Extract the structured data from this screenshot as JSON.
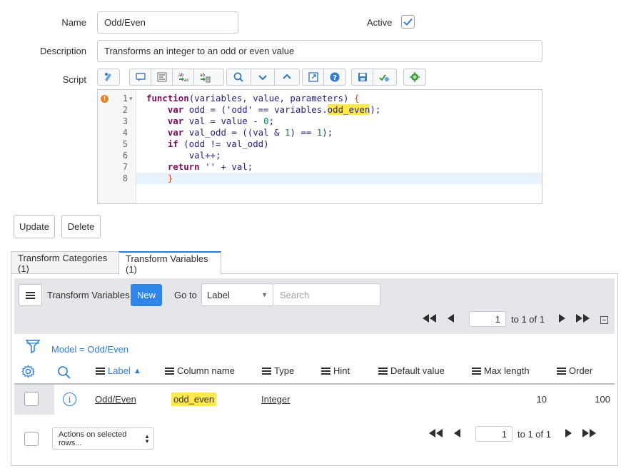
{
  "form": {
    "name_label": "Name",
    "name_value": "Odd/Even",
    "active_label": "Active",
    "active_checked": true,
    "description_label": "Description",
    "description_value": "Transforms an integer to an odd or even value",
    "script_label": "Script"
  },
  "toolbar": {
    "icons": [
      "script-assist-icon",
      "comment-icon",
      "format-icon",
      "replace-icon",
      "replace-all-icon",
      "search-icon",
      "collapse-icon",
      "expand-icon",
      "fullscreen-icon",
      "help-icon",
      "save-icon",
      "syntax-check-icon",
      "debug-icon"
    ]
  },
  "editor": {
    "line_numbers": [
      "1",
      "2",
      "3",
      "4",
      "5",
      "6",
      "7",
      "8"
    ],
    "fold_marker": "▾",
    "error_marker": "!",
    "lines": [
      {
        "indent": "",
        "parts": [
          [
            "kw",
            "function"
          ],
          [
            "p",
            "(variables, value, parameters) "
          ],
          [
            "brace",
            "{"
          ]
        ]
      },
      {
        "indent": "    ",
        "parts": [
          [
            "kw",
            "var"
          ],
          [
            "p",
            " odd = ("
          ],
          [
            "str",
            "'odd'"
          ],
          [
            "p",
            " == variables."
          ],
          [
            "hl",
            "odd_even"
          ],
          [
            "p",
            ");"
          ]
        ]
      },
      {
        "indent": "    ",
        "parts": [
          [
            "kw",
            "var"
          ],
          [
            "p",
            " val = value - "
          ],
          [
            "num",
            "0"
          ],
          [
            "p",
            ";"
          ]
        ]
      },
      {
        "indent": "    ",
        "parts": [
          [
            "kw",
            "var"
          ],
          [
            "p",
            " val_odd = ((val & "
          ],
          [
            "num",
            "1"
          ],
          [
            "p",
            ") == "
          ],
          [
            "num",
            "1"
          ],
          [
            "p",
            ");"
          ]
        ]
      },
      {
        "indent": "    ",
        "parts": [
          [
            "kw",
            "if"
          ],
          [
            "p",
            " (odd != val_odd)"
          ]
        ]
      },
      {
        "indent": "        ",
        "parts": [
          [
            "p",
            "val++;"
          ]
        ]
      },
      {
        "indent": "    ",
        "parts": [
          [
            "kw",
            "return"
          ],
          [
            "p",
            " "
          ],
          [
            "str",
            "''"
          ],
          [
            "p",
            " + val;"
          ]
        ]
      },
      {
        "indent": "    ",
        "parts": [
          [
            "brace",
            "}"
          ]
        ]
      }
    ]
  },
  "actions": {
    "update_label": "Update",
    "delete_label": "Delete"
  },
  "tabs": [
    {
      "label": "Transform Categories (1)",
      "active": false
    },
    {
      "label": "Transform Variables (1)",
      "active": true
    }
  ],
  "list": {
    "title": "Transform Variables",
    "new_label": "New",
    "goto_label": "Go to",
    "goto_select": "Label",
    "search_placeholder": "Search",
    "page_input": "1",
    "page_of": "to 1 of 1",
    "breadcrumb": "Model = Odd/Even",
    "columns": [
      "Label",
      "Column name",
      "Type",
      "Hint",
      "Default value",
      "Max length",
      "Order"
    ],
    "sort_indicator": "▲",
    "rows": [
      {
        "label": "Odd/Even",
        "column_name": "odd_even",
        "type": "Integer",
        "hint": "",
        "default_value": "",
        "max_length": "10",
        "order": "100"
      }
    ],
    "actions_select": "Actions on selected rows...",
    "footer_page_input": "1",
    "footer_page_of": "to 1 of 1"
  },
  "colors": {
    "accent": "#2f7dd1",
    "highlight": "#ffe84d",
    "header_bg": "#e4e6e9",
    "error": "#f0811f"
  }
}
